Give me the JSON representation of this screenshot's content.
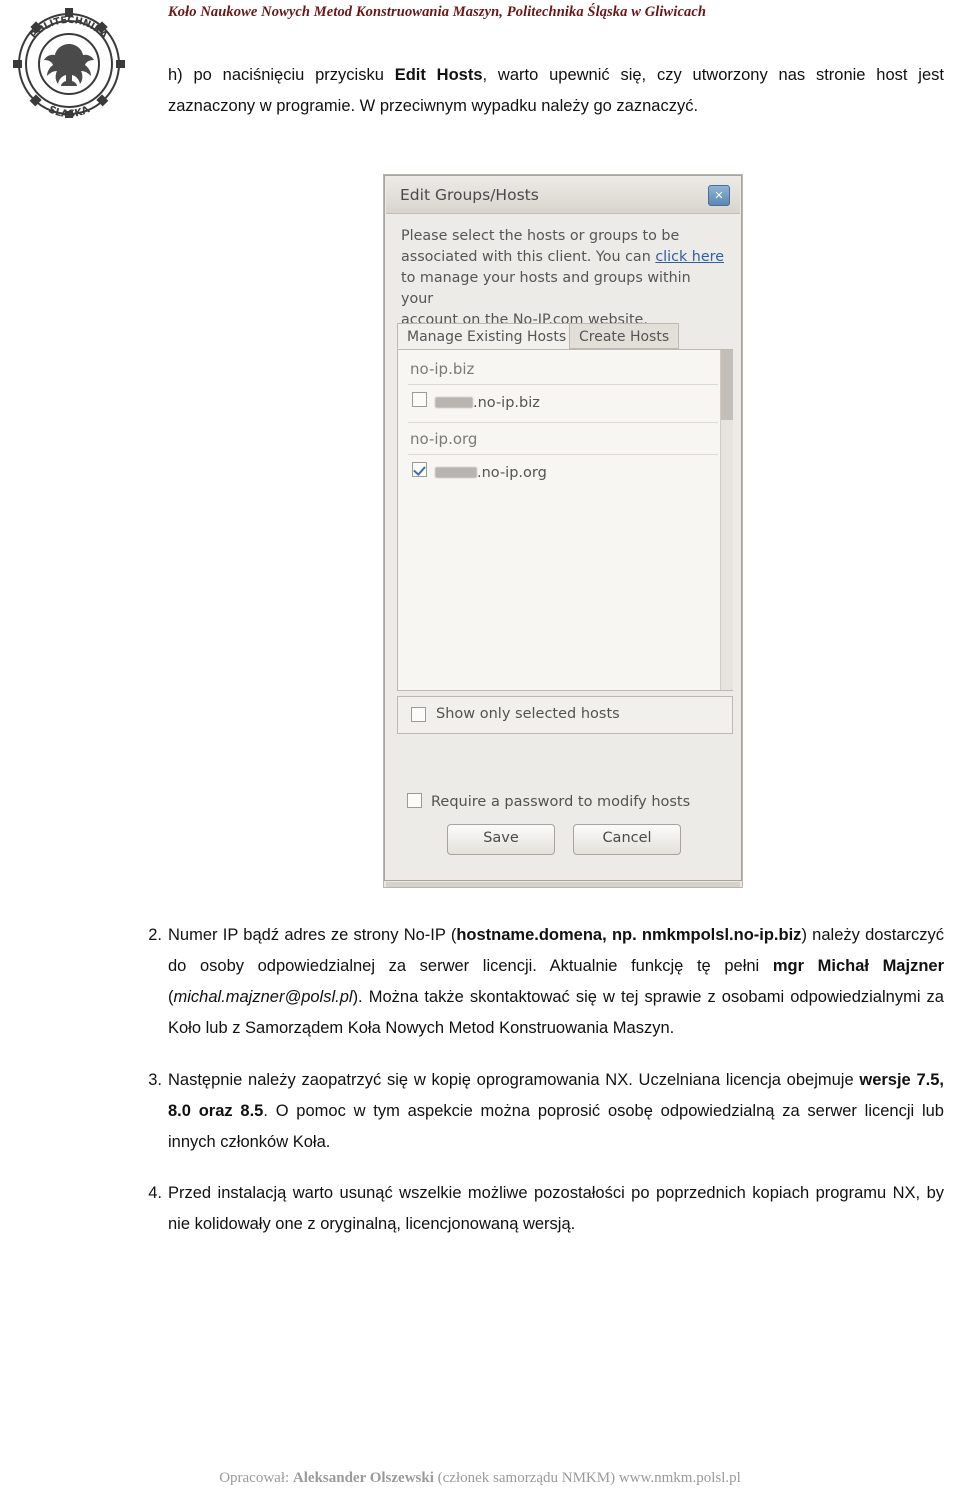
{
  "header": {
    "title": "Koło Naukowe Nowych Metod Konstruowania Maszyn, Politechnika Śląska w Gliwicach",
    "logo_text_top": "POLITECHNIKA",
    "logo_text_bottom": "ŚLĄSKA",
    "title_color": "#6b1515"
  },
  "paragraphs": {
    "h_marker": "h)",
    "h_text_1": "po naciśnięciu przycisku ",
    "h_bold": "Edit Hosts",
    "h_text_2": ", warto upewnić się, czy utworzony nas stronie host jest zaznaczony w programie. W przeciwnym wypadku należy go zaznaczyć."
  },
  "dialog": {
    "title": "Edit Groups/Hosts",
    "close_label": "✕",
    "instructions_line1": "Please select the hosts or groups to be",
    "instructions_line2_a": "associated with this client. You can ",
    "instructions_link": "click here",
    "instructions_line3": "to manage your hosts and groups within your",
    "instructions_line4": "account on the No-IP.com website.",
    "tab_active": "Manage Existing Hosts",
    "tab_inactive": "Create Hosts",
    "groups": [
      {
        "name": "no-ip.biz",
        "hosts": [
          {
            "label": ".no-ip.biz",
            "checked": false,
            "blur_width": 38
          }
        ]
      },
      {
        "name": "no-ip.org",
        "hosts": [
          {
            "label": ".no-ip.org",
            "checked": true,
            "blur_width": 42
          }
        ]
      }
    ],
    "show_only_selected": "Show only selected hosts",
    "require_password": "Require a password to modify hosts",
    "save_button": "Save",
    "cancel_button": "Cancel"
  },
  "items": {
    "item2": {
      "num": "2.",
      "t1": "Numer IP bądź adres ze strony No-IP (",
      "b1": "hostname.domena, np. nmkmpolsl.no-ip.biz",
      "t2": ") należy dostarczyć do osoby odpowiedzialnej za serwer licencji. Aktualnie funkcję tę pełni ",
      "b2": "mgr Michał Majzner",
      "t3": " (",
      "i1": "michal.majzner@polsl.pl",
      "t4": "). Można także skontaktować się w tej sprawie z osobami odpowiedzialnymi za Koło lub z Samorządem Koła Nowych Metod Konstruowania Maszyn."
    },
    "item3": {
      "num": "3.",
      "t1": "Następnie należy zaopatrzyć się w kopię oprogramowania NX. Uczelniana licencja obejmuje ",
      "b1": "wersje 7.5, 8.0 oraz 8.5",
      "t2": ". O pomoc w tym aspekcie można poprosić osobę odpowiedzialną za serwer licencji lub innych członków Koła."
    },
    "item4": {
      "num": "4.",
      "t1": "Przed instalacją warto usunąć wszelkie możliwe pozostałości po poprzednich kopiach programu NX, by nie kolidowały one z oryginalną, licencjonowaną wersją."
    }
  },
  "footer": {
    "prefix": "Opracował: ",
    "author": "Aleksander Olszewski",
    "suffix": " (członek samorządu NMKM) www.nmkm.polsl.pl"
  }
}
